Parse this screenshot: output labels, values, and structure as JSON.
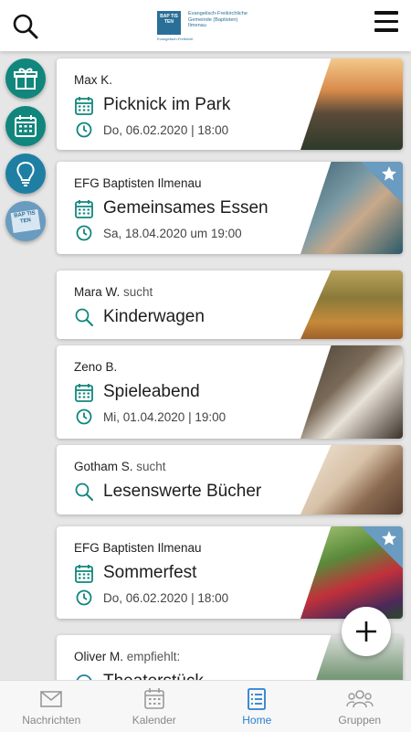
{
  "header": {
    "logo_box": "BAP TIS TEN",
    "logo_line1": "Evangelisch-Freikirchliche",
    "logo_line2": "Gemeinde (Baptisten)",
    "logo_line3": "Ilmenau",
    "logo_tagline": "Evangelisch-Freikirchl."
  },
  "side": {
    "baptisten_label": "BAP TIS TEN"
  },
  "cards": [
    {
      "author": "Max K.",
      "author_suffix": "",
      "title": "Picknick im Park",
      "date": "Do, 06.02.2020 | 18:00",
      "kind": "event",
      "starred": false
    },
    {
      "author": "EFG Baptisten Ilmenau",
      "author_suffix": "",
      "title": "Gemeinsames Essen",
      "date": "Sa, 18.04.2020 um 19:00",
      "kind": "event",
      "starred": true
    },
    {
      "author": "Mara W.",
      "author_suffix": " sucht",
      "title": "Kinderwagen",
      "date": "",
      "kind": "search",
      "starred": false
    },
    {
      "author": "Zeno B.",
      "author_suffix": "",
      "title": "Spieleabend",
      "date": "Mi, 01.04.2020 | 19:00",
      "kind": "event",
      "starred": false
    },
    {
      "author": "Gotham S.",
      "author_suffix": " sucht",
      "title": "Lesenswerte Bücher",
      "date": "",
      "kind": "search",
      "starred": false
    },
    {
      "author": "EFG Baptisten Ilmenau",
      "author_suffix": "",
      "title": "Sommerfest",
      "date": "Do, 06.02.2020 | 18:00",
      "kind": "event",
      "starred": true
    },
    {
      "author": "Oliver M.",
      "author_suffix": " empfiehlt:",
      "title": "Theaterstück",
      "date": "",
      "kind": "recommend",
      "starred": false
    }
  ],
  "nav": {
    "items": [
      {
        "label": "Nachrichten"
      },
      {
        "label": "Kalender"
      },
      {
        "label": "Home"
      },
      {
        "label": "Gruppen"
      }
    ]
  },
  "colors": {
    "teal": "#11867c",
    "blue": "#1f7fa3",
    "active": "#2a7fd0"
  }
}
